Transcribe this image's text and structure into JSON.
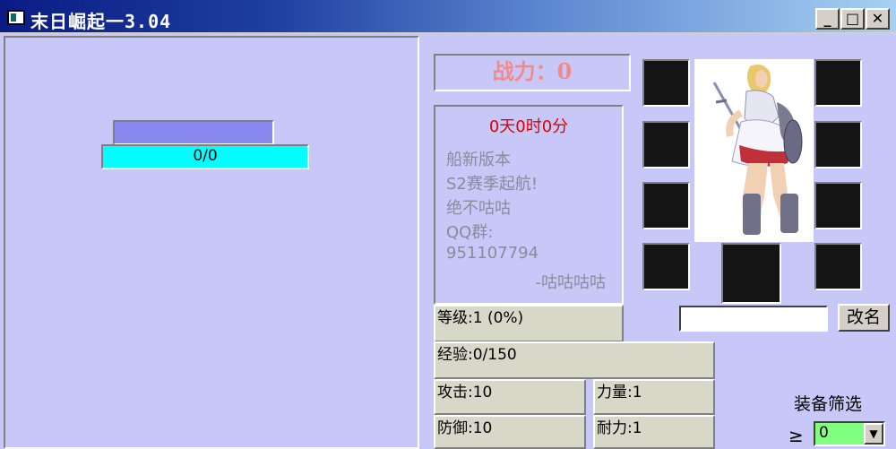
{
  "window": {
    "title": "末日崛起一3.04",
    "controls": {
      "minimize": "_",
      "maximize": "□",
      "close": "✕"
    }
  },
  "progress": {
    "value_text": "0/0",
    "fill": 0
  },
  "status": {
    "power_text": "战力：0"
  },
  "notice": {
    "time": "0天0时0分",
    "lines": [
      "船新版本",
      "S2赛季起航!",
      "绝不咕咕",
      "QQ群:",
      "951107794"
    ],
    "signature": "-咕咕咕咕"
  },
  "rename": {
    "input_value": "",
    "button_label": "改名"
  },
  "stats": {
    "level": "等级:1 (0%)",
    "exp": "经验:0/150",
    "attack": "攻击:10",
    "strength": "力量:1",
    "defense": "防御:10",
    "endurance": "耐力:1"
  },
  "filter": {
    "label": "装备筛选",
    "operator": "≥",
    "selected": "0"
  },
  "colors": {
    "power": "#f28a8a",
    "time": "#e00000",
    "progress_fill": "#00ffff",
    "panel_bg": "#c8c8f8"
  }
}
